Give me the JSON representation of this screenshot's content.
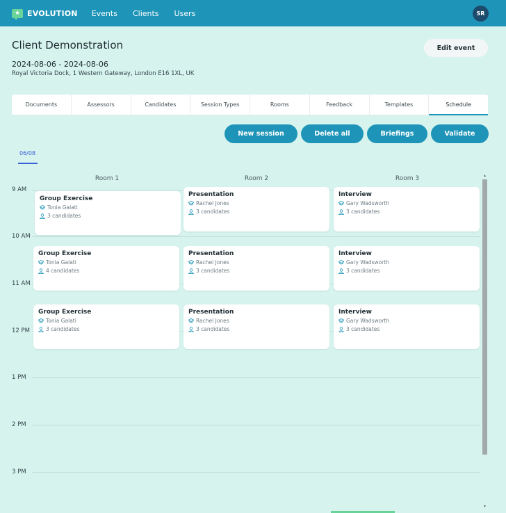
{
  "nav": {
    "brand": "EVOLUTION",
    "links": [
      "Events",
      "Clients",
      "Users"
    ],
    "avatar_initials": "SR"
  },
  "header": {
    "title": "Client Demonstration",
    "dates": "2024-08-06 - 2024-08-06",
    "address": "Royal Victoria Dock, 1 Western Gateway, London E16 1XL, UK",
    "edit_label": "Edit event"
  },
  "tabs": [
    "Documents",
    "Assessors",
    "Candidates",
    "Session Types",
    "Rooms",
    "Feedback",
    "Templates",
    "Schedule"
  ],
  "active_tab": "Schedule",
  "actions": [
    "New session",
    "Delete all",
    "Briefings",
    "Validate"
  ],
  "date_tab": "06/08",
  "rooms": [
    "Room 1",
    "Room 2",
    "Room 3"
  ],
  "times": [
    "9 AM",
    "10 AM",
    "11 AM",
    "12 PM",
    "1 PM",
    "2 PM",
    "3 PM"
  ],
  "sessions": [
    {
      "title": "Group Exercise",
      "assessor": "Tonia Galati",
      "candidates": "3 candidates"
    },
    {
      "title": "Presentation",
      "assessor": "Rachel Jones",
      "candidates": "3 candidates"
    },
    {
      "title": "Interview",
      "assessor": "Gary Wadsworth",
      "candidates": "3 candidates"
    },
    {
      "title": "Group Exercise",
      "assessor": "Tonia Galati",
      "candidates": "4 candidates"
    },
    {
      "title": "Presentation",
      "assessor": "Rachel Jones",
      "candidates": "3 candidates"
    },
    {
      "title": "Interview",
      "assessor": "Gary Wadsworth",
      "candidates": "3 candidates"
    },
    {
      "title": "Group Exercise",
      "assessor": "Tonia Galati",
      "candidates": "3 candidates"
    },
    {
      "title": "Presentation",
      "assessor": "Rachel Jones",
      "candidates": "3 candidates"
    },
    {
      "title": "Interview",
      "assessor": "Gary Wadsworth",
      "candidates": "3 candidates"
    }
  ],
  "colors": {
    "primary": "#1e95b8",
    "background": "#d6f3ee",
    "accent_green": "#6ad39a",
    "date_blue": "#3b61d6",
    "avatar": "#1c4b6b"
  },
  "icons": [
    "chat-logo-icon",
    "graduation-cap-icon",
    "person-icon",
    "scroll-up-icon",
    "scroll-down-icon"
  ]
}
